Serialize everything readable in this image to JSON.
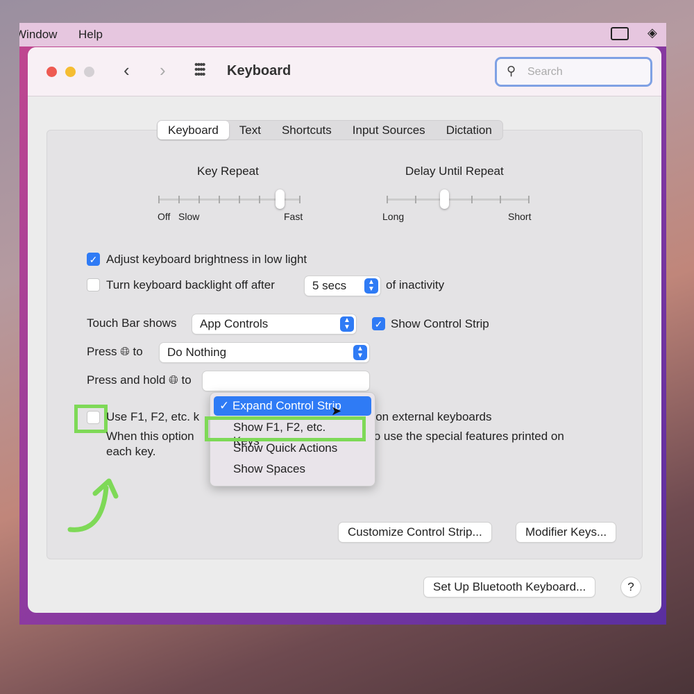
{
  "menubar": {
    "items": [
      "Window",
      "Help"
    ],
    "right_icons": [
      "screen-record-icon",
      "layers-icon"
    ]
  },
  "window": {
    "title": "Keyboard",
    "search_placeholder": "Search"
  },
  "tabs": [
    {
      "label": "Keyboard",
      "active": true
    },
    {
      "label": "Text"
    },
    {
      "label": "Shortcuts"
    },
    {
      "label": "Input Sources"
    },
    {
      "label": "Dictation"
    }
  ],
  "key_repeat": {
    "label": "Key Repeat",
    "min_labels": [
      "Off",
      "Slow"
    ],
    "max_label": "Fast",
    "ticks": 8,
    "value_index": 6
  },
  "delay_until_repeat": {
    "label": "Delay Until Repeat",
    "min_label": "Long",
    "max_label": "Short",
    "ticks": 6,
    "value_index": 2
  },
  "options": {
    "adjust_brightness": {
      "label": "Adjust keyboard brightness in low light",
      "checked": true
    },
    "backlight_off": {
      "label": "Turn keyboard backlight off after",
      "checked": false,
      "value": "5 secs",
      "suffix": "of inactivity"
    },
    "touch_bar": {
      "label": "Touch Bar shows",
      "value": "App Controls",
      "show_control_strip": {
        "label": "Show Control Strip",
        "checked": true
      }
    },
    "press_globe": {
      "label_pre": "Press",
      "label_post": "to",
      "value": "Do Nothing"
    },
    "press_hold_globe": {
      "label_pre": "Press and hold",
      "label_post": "to"
    },
    "fn_keys": {
      "label_start": "Use F1, F2, etc. k",
      "label_end": "s on external keyboards",
      "desc_start": "When this option",
      "desc_end": "to use the special features printed on",
      "desc_line2": "each key.",
      "checked": false
    }
  },
  "dropdown": {
    "items": [
      {
        "label": "Expand Control Strip",
        "selected": true
      },
      {
        "label": "Show F1, F2, etc. Keys"
      },
      {
        "label": "Show Quick Actions"
      },
      {
        "label": "Show Spaces"
      }
    ]
  },
  "buttons": {
    "customize": "Customize Control Strip...",
    "modifier": "Modifier Keys...",
    "bluetooth": "Set Up Bluetooth Keyboard...",
    "help": "?"
  },
  "colors": {
    "accent": "#2f7bf5",
    "highlight": "#7ed957"
  }
}
